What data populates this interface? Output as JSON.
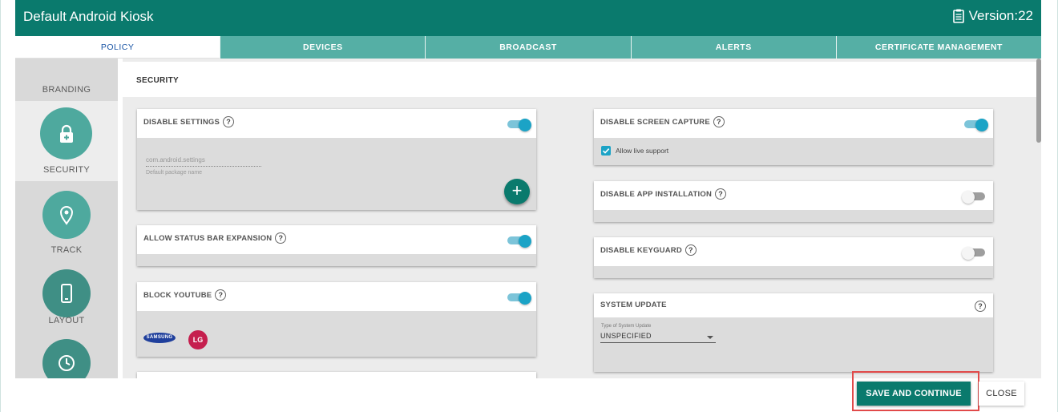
{
  "header": {
    "title": "Default Android Kiosk",
    "version_label": "Version:22",
    "version_icon": "clipboard-icon"
  },
  "tabs": [
    {
      "label": "POLICY",
      "active": true
    },
    {
      "label": "DEVICES",
      "active": false
    },
    {
      "label": "BROADCAST",
      "active": false
    },
    {
      "label": "ALERTS",
      "active": false
    },
    {
      "label": "CERTIFICATE MANAGEMENT",
      "active": false
    }
  ],
  "sidebar": {
    "items": [
      {
        "label": "BRANDING",
        "icon": "branding-icon"
      },
      {
        "label": "SECURITY",
        "icon": "lock-icon",
        "active": true
      },
      {
        "label": "TRACK",
        "icon": "location-pin-icon"
      },
      {
        "label": "LAYOUT",
        "icon": "phone-icon"
      },
      {
        "label": "",
        "icon": "clock-icon"
      }
    ]
  },
  "section": {
    "title": "SECURITY"
  },
  "cards": {
    "disable_settings": {
      "label": "DISABLE SETTINGS",
      "enabled": true,
      "package_value": "com.android.settings",
      "package_helper": "Default package name",
      "add_label": "+"
    },
    "allow_status_bar": {
      "label": "ALLOW STATUS BAR EXPANSION",
      "enabled": true
    },
    "block_youtube": {
      "label": "BLOCK YOUTUBE",
      "enabled": true,
      "brands": [
        "SAMSUNG",
        "LG"
      ]
    },
    "disable_screen_capture": {
      "label": "DISABLE SCREEN CAPTURE",
      "enabled": true,
      "allow_live_support_label": "Allow live support",
      "allow_live_support_checked": true
    },
    "disable_app_installation": {
      "label": "DISABLE APP INSTALLATION",
      "enabled": false
    },
    "disable_keyguard": {
      "label": "DISABLE KEYGUARD",
      "enabled": false
    },
    "system_update": {
      "label": "SYSTEM UPDATE",
      "type_label": "Type of System Update",
      "type_value": "UNSPECIFIED"
    }
  },
  "help_glyph": "?",
  "footer": {
    "save_label": "SAVE AND CONTINUE",
    "close_label": "CLOSE"
  },
  "colors": {
    "primary": "#0a7a6d",
    "tab_bg": "#55afa5",
    "toggle_on": "#1ba3c6",
    "highlight": "#e14a4a"
  }
}
